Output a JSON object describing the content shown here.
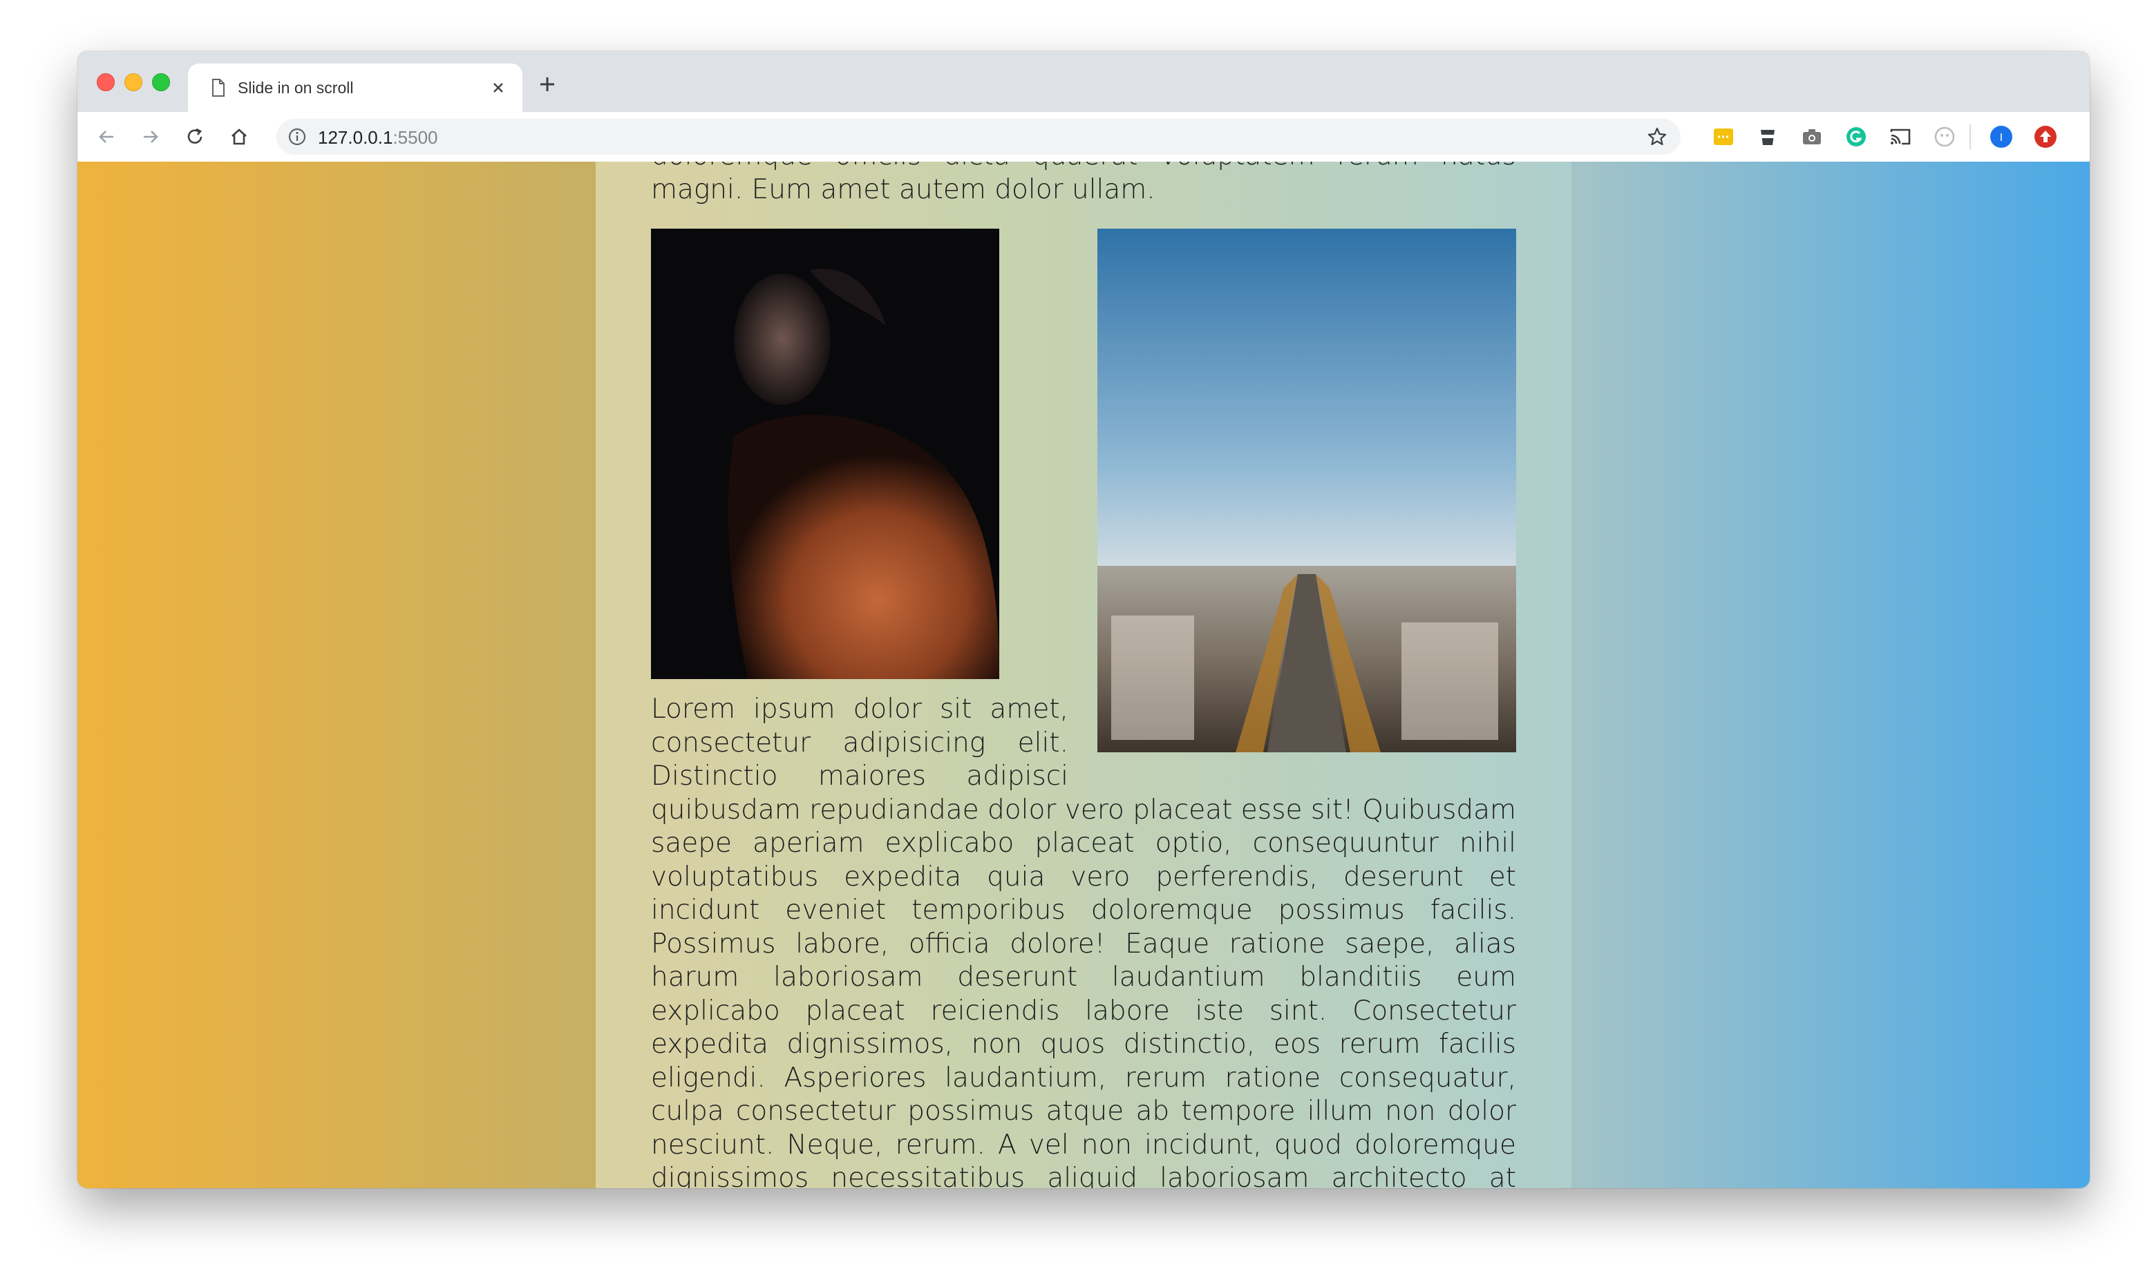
{
  "browser": {
    "tab_title": "Slide in on scroll",
    "url_host": "127.0.0.1",
    "url_port": ":5500"
  },
  "toolbar": {
    "extensions": [
      "notes-extension-icon",
      "cup-extension-icon",
      "camera-extension-icon",
      "grammarly-icon",
      "cast-icon",
      "ghostery-icon",
      "profile-avatar",
      "update-icon"
    ],
    "profile_initial": "I"
  },
  "article": {
    "intro_text": "doloremque officiis dicta quaerat voluptatem rerum natus magni. Eum amet autem dolor ullam.",
    "body_text": "Lorem ipsum dolor sit amet, consectetur adipisicing elit. Distinctio maiores adipisci quibusdam repudiandae dolor vero placeat esse sit! Quibusdam saepe aperiam explicabo placeat optio, consequuntur nihil voluptatibus expedita quia vero perferendis, deserunt et incidunt eveniet temporibus doloremque possimus facilis. Possimus labore, officia dolore! Eaque ratione saepe, alias harum laboriosam deserunt laudantium blanditiis eum explicabo placeat reiciendis labore iste sint. Consectetur expedita dignissimos, non quos distinctio, eos rerum facilis eligendi. Asperiores laudantium, rerum ratione consequatur, culpa consectetur possimus atque ab tempore illum non dolor nesciunt. Neque, rerum. A vel non incidunt, quod doloremque dignissimos necessitatibus aliquid laboriosam architecto at cupiditate commodi expedita in, quae blanditiis. Deserunt labore sequi, repellat laboriosam est, doloremque culpa reiciendis tempore excepturi. Enim"
  },
  "colors": {
    "left_gradient": "#efb23d",
    "right_gradient": "#4aa8e6",
    "text": "#1c1c1c"
  }
}
